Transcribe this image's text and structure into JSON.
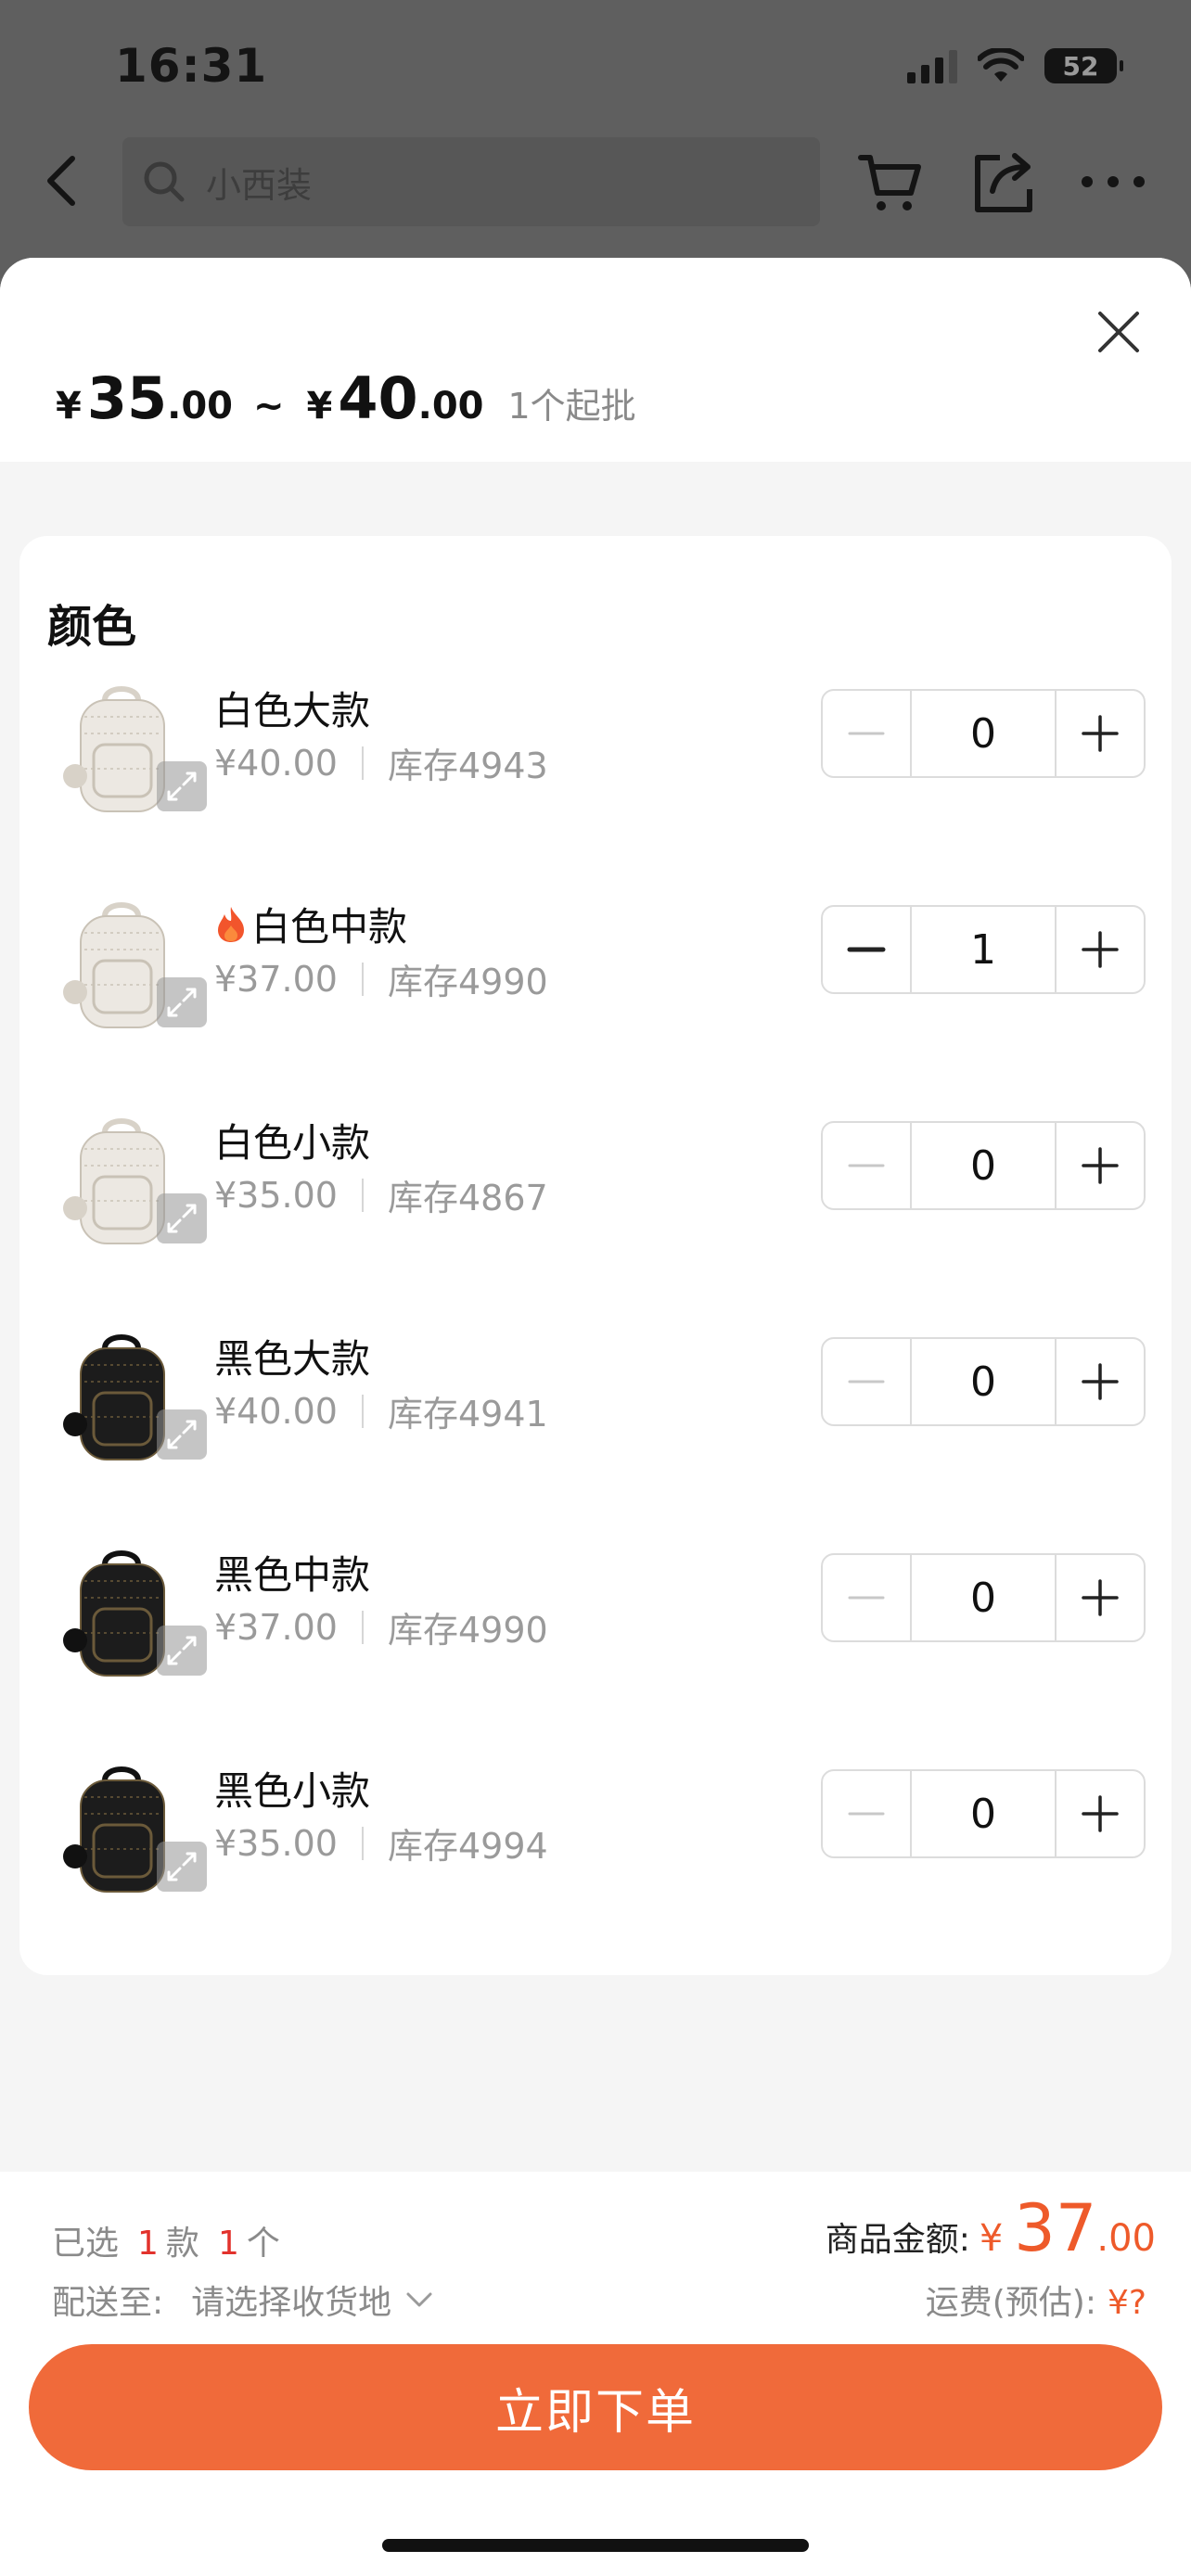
{
  "status": {
    "time": "16:31",
    "battery": "52"
  },
  "topbar": {
    "search_placeholder": "小西装"
  },
  "sheet": {
    "price_min_int": "35",
    "price_min_dec": ".00",
    "price_max_int": "40",
    "price_max_dec": ".00",
    "currency": "¥",
    "tilde": "~",
    "min_order": "1个起批",
    "section_title": "颜色",
    "variants": [
      {
        "name": "白色大款",
        "price": "¥40.00",
        "stock": "库存4943",
        "qty": "0",
        "hot": false,
        "tone": "white"
      },
      {
        "name": "白色中款",
        "price": "¥37.00",
        "stock": "库存4990",
        "qty": "1",
        "hot": true,
        "tone": "white"
      },
      {
        "name": "白色小款",
        "price": "¥35.00",
        "stock": "库存4867",
        "qty": "0",
        "hot": false,
        "tone": "white"
      },
      {
        "name": "黑色大款",
        "price": "¥40.00",
        "stock": "库存4941",
        "qty": "0",
        "hot": false,
        "tone": "black"
      },
      {
        "name": "黑色中款",
        "price": "¥37.00",
        "stock": "库存4990",
        "qty": "0",
        "hot": false,
        "tone": "black"
      },
      {
        "name": "黑色小款",
        "price": "¥35.00",
        "stock": "库存4994",
        "qty": "0",
        "hot": false,
        "tone": "black"
      }
    ]
  },
  "footer": {
    "selected_prefix": "已选",
    "selected_styles": "1",
    "styles_unit": "款",
    "selected_count": "1",
    "count_unit": "个",
    "amount_label": "商品金额:",
    "amount_currency": "¥",
    "amount_int": "37",
    "amount_dec": ".00",
    "ship_label": "配送至:",
    "ship_value": "请选择收货地",
    "freight_label": "运费(预估):",
    "freight_value": "¥?",
    "order_button": "立即下单"
  },
  "colors": {
    "accent": "#f06a3a",
    "price_red": "#ee5a2a",
    "count_red": "#e2322c"
  }
}
